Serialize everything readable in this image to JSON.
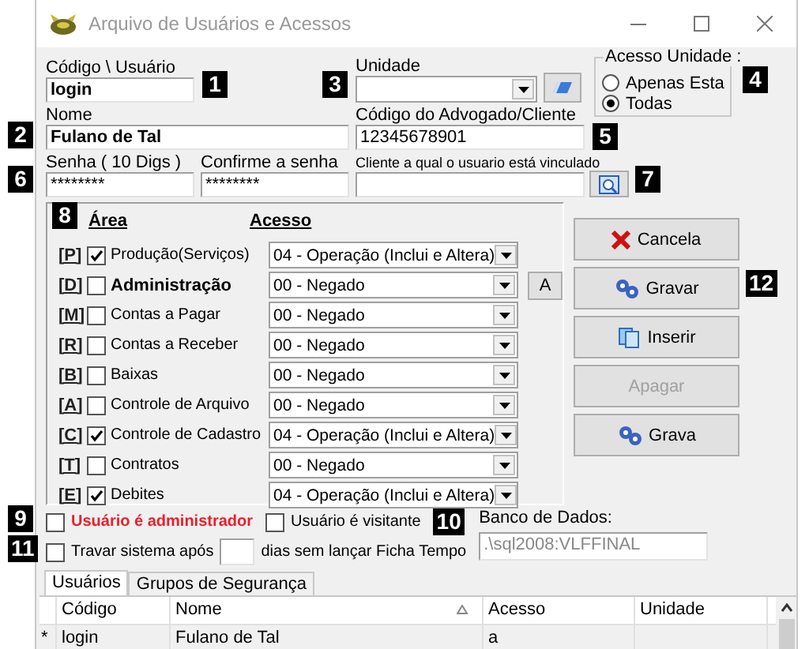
{
  "window": {
    "title": "Arquivo de Usuários e Acessos"
  },
  "badges": [
    "1",
    "2",
    "3",
    "4",
    "5",
    "6",
    "7",
    "8",
    "9",
    "10",
    "11",
    "12"
  ],
  "codigo": {
    "label": "Código \\ Usuário",
    "value": "login"
  },
  "unidade": {
    "label": "Unidade"
  },
  "acesso_unidade": {
    "title": "Acesso Unidade :",
    "options": [
      {
        "label": "Apenas Esta",
        "selected": false
      },
      {
        "label": "Todas",
        "selected": true
      }
    ]
  },
  "nome": {
    "label": "Nome",
    "value": "Fulano de Tal"
  },
  "codigo_advogado": {
    "label": "Código do Advogado/Cliente",
    "value": "12345678901"
  },
  "senha": {
    "label": "Senha ( 10 Digs )",
    "value": "********"
  },
  "confirme": {
    "label": "Confirme a senha",
    "value": "********"
  },
  "cliente": {
    "label": "Cliente a qual o usuario está vinculado"
  },
  "areas_header": {
    "area": "Área",
    "acesso": "Acesso"
  },
  "areas": [
    {
      "key": "[P]",
      "label": "Produção(Serviços)",
      "checked": true,
      "bold": false,
      "access": "04 - Operação (Inclui e Altera)"
    },
    {
      "key": "[D]",
      "label": "Administração",
      "checked": false,
      "bold": true,
      "access": "00 - Negado",
      "button": "A"
    },
    {
      "key": "[M]",
      "label": "Contas a Pagar",
      "checked": false,
      "bold": false,
      "access": "00 - Negado"
    },
    {
      "key": "[R]",
      "label": "Contas a Receber",
      "checked": false,
      "bold": false,
      "access": "00 - Negado"
    },
    {
      "key": "[B]",
      "label": "Baixas",
      "checked": false,
      "bold": false,
      "access": "00 - Negado"
    },
    {
      "key": "[A]",
      "label": "Controle de Arquivo",
      "checked": false,
      "bold": false,
      "access": "00 - Negado"
    },
    {
      "key": "[C]",
      "label": "Controle de Cadastro",
      "checked": true,
      "bold": false,
      "access": "04 - Operação (Inclui e Altera)"
    },
    {
      "key": "[T]",
      "label": "Contratos",
      "checked": false,
      "bold": false,
      "access": "00 - Negado"
    },
    {
      "key": "[E]",
      "label": "Debites",
      "checked": true,
      "bold": false,
      "access": "04 - Operação (Inclui e Altera)"
    }
  ],
  "actions": [
    {
      "label": "Cancela",
      "kind": "cancel",
      "disabled": false
    },
    {
      "label": "Gravar",
      "kind": "save",
      "disabled": false
    },
    {
      "label": "Inserir",
      "kind": "insert",
      "disabled": false
    },
    {
      "label": "Apagar",
      "kind": "plain",
      "disabled": true
    },
    {
      "label": "Grava",
      "kind": "save",
      "disabled": false
    }
  ],
  "admin": {
    "label": "Usuário é administrador",
    "checked": false
  },
  "visitante": {
    "label": "Usuário é visitante",
    "checked": false
  },
  "travar": {
    "label": "Travar sistema após",
    "checked": false,
    "suffix": "dias sem lançar Ficha Tempo"
  },
  "banco": {
    "label": "Banco de Dados:",
    "value": ".\\sql2008:VLFFINAL"
  },
  "tabs": [
    {
      "label": "Usuários",
      "selected": true
    },
    {
      "label": "Grupos de Segurança",
      "selected": false
    }
  ],
  "table": {
    "columns": [
      "Código",
      "Nome",
      "Acesso",
      "Unidade"
    ],
    "rows": [
      {
        "indicator": "*",
        "cells": [
          "login",
          "Fulano de Tal",
          "a",
          ""
        ]
      }
    ]
  }
}
